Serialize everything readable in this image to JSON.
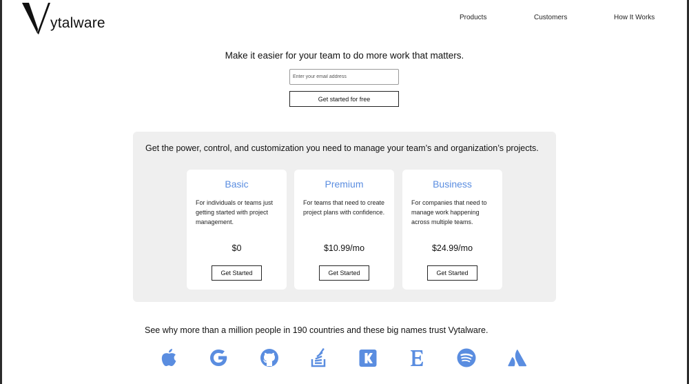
{
  "header": {
    "logo_text": "ytalware",
    "logo_icon": "v-logo-icon",
    "nav": [
      "Products",
      "Customers",
      "How It Works"
    ]
  },
  "hero": {
    "title": "Make it easier for your team to do more work that matters.",
    "email_placeholder": "Enter your email address",
    "cta_label": "Get started for free"
  },
  "pricing": {
    "heading": "Get the power, control, and customization you need to manage your team’s and organization’s projects.",
    "plans": [
      {
        "name": "Basic",
        "description": "For individuals or teams just getting started with project management.",
        "price": "$0",
        "button": "Get Started"
      },
      {
        "name": "Premium",
        "description": "For teams that need to create project plans with confidence.",
        "price": "$10.99/mo",
        "button": "Get Started"
      },
      {
        "name": "Business",
        "description": "For companies that need to manage work happening across multiple teams.",
        "price": "$24.99/mo",
        "button": "Get Started"
      }
    ]
  },
  "trust": {
    "text": "See why more than a million people in 190 countries and these big names trust Vytalware.",
    "brands": [
      "apple-icon",
      "google-icon",
      "github-icon",
      "stack-overflow-icon",
      "kickstarter-icon",
      "etsy-icon",
      "spotify-icon",
      "atlassian-icon"
    ]
  },
  "colors": {
    "accent": "#5a8de0",
    "panel": "#efefef"
  }
}
